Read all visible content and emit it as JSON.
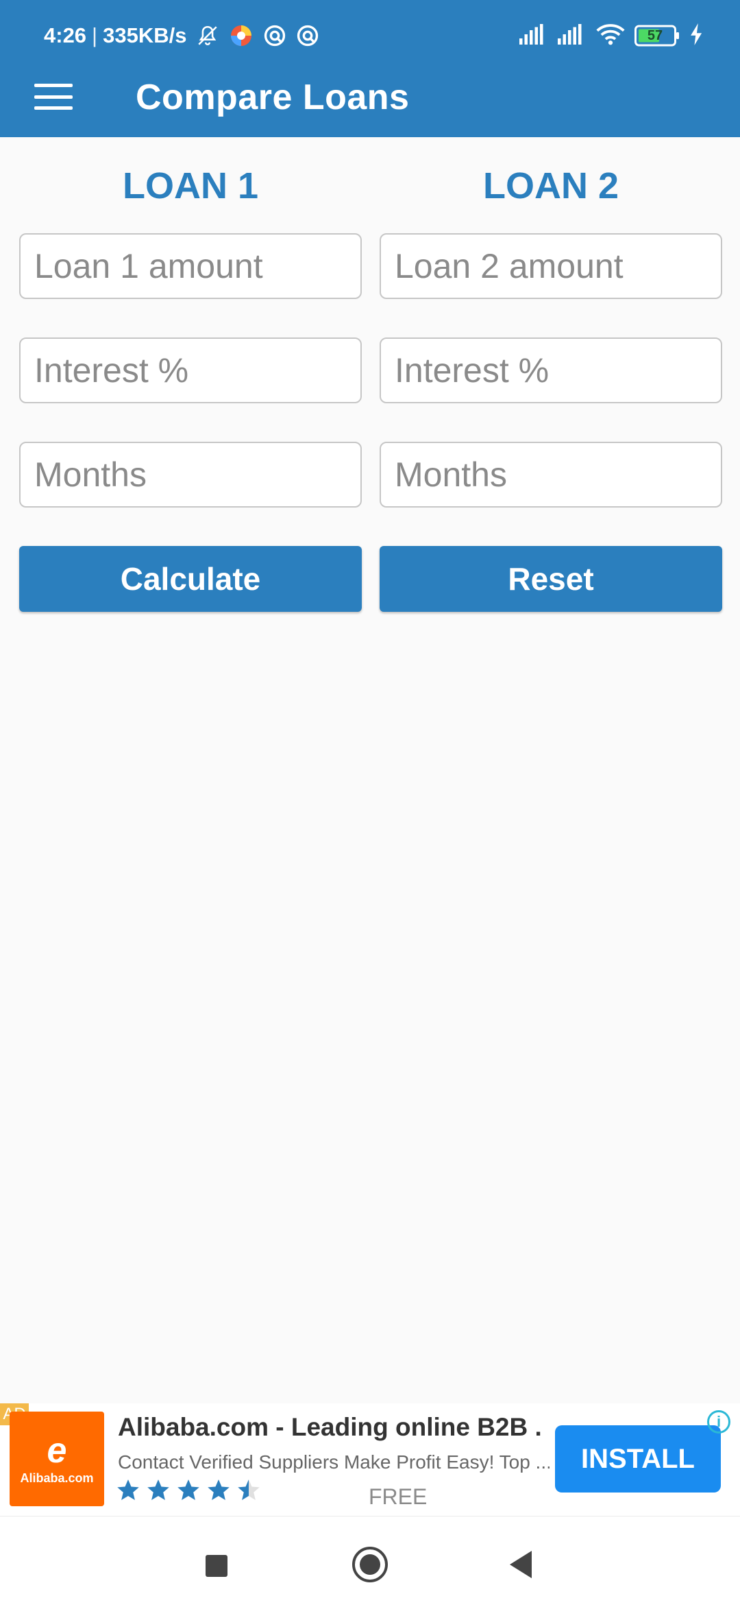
{
  "status_bar": {
    "time": "4:26",
    "network_speed": "335KB/s",
    "battery": "57",
    "icons": [
      "bell-off-icon",
      "browser-icon",
      "vpn-icon",
      "vpn-icon",
      "signal-icon",
      "signal-icon",
      "wifi-icon",
      "battery-icon",
      "charging-icon"
    ]
  },
  "appbar": {
    "title": "Compare Loans",
    "menu_icon": "menu-icon",
    "color": "#2b7fbe"
  },
  "loan1": {
    "heading": "LOAN 1",
    "amount_placeholder": "Loan 1 amount",
    "interest_placeholder": "Interest %",
    "months_placeholder": "Months",
    "button": "Calculate"
  },
  "loan2": {
    "heading": "LOAN 2",
    "amount_placeholder": "Loan 2 amount",
    "interest_placeholder": "Interest %",
    "months_placeholder": "Months",
    "button": "Reset"
  },
  "ad": {
    "badge": "AD",
    "logo_mark": "e",
    "logo_text": "Alibaba.com",
    "title": "Alibaba.com - Leading online B2B ...",
    "description": "Contact Verified Suppliers Make Profit Easy! Top ...",
    "rating": 4.5,
    "price": "FREE",
    "install": "INSTALL",
    "info_icon": "i"
  },
  "colors": {
    "primary": "#2b7fbe",
    "install": "#1a8cf0",
    "ad_logo": "#ff6a00"
  }
}
